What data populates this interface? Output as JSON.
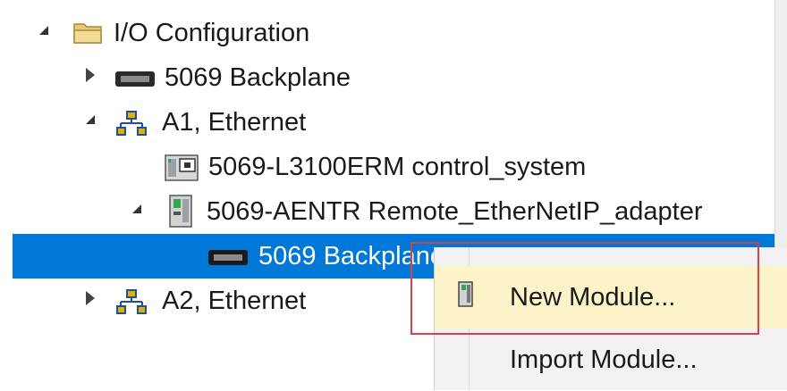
{
  "tree": {
    "items": [
      {
        "label": "I/O Configuration",
        "icon": "folder-icon",
        "state": "expanded"
      },
      {
        "label": "5069 Backplane",
        "icon": "backplane-icon",
        "state": "collapsed"
      },
      {
        "label": "A1, Ethernet",
        "icon": "ethernet-network-icon",
        "state": "expanded"
      },
      {
        "label": "5069-L3100ERM control_system",
        "icon": "controller-icon",
        "state": "leaf"
      },
      {
        "label": "5069-AENTR Remote_EtherNetIP_adapter",
        "icon": "adapter-module-icon",
        "state": "expanded"
      },
      {
        "label": "5069 Backplane",
        "icon": "backplane-icon",
        "state": "selected"
      },
      {
        "label": "A2, Ethernet",
        "icon": "ethernet-network-icon",
        "state": "collapsed"
      }
    ]
  },
  "context_menu": {
    "items": [
      {
        "label": "New Module...",
        "icon": "module-icon",
        "state": "hovered"
      },
      {
        "label": "Import Module...",
        "icon": "",
        "state": "normal"
      }
    ]
  },
  "colors": {
    "selection": "#0078d7",
    "menu_hover": "#fcf3c9",
    "highlight_outline": "#d9414a"
  }
}
